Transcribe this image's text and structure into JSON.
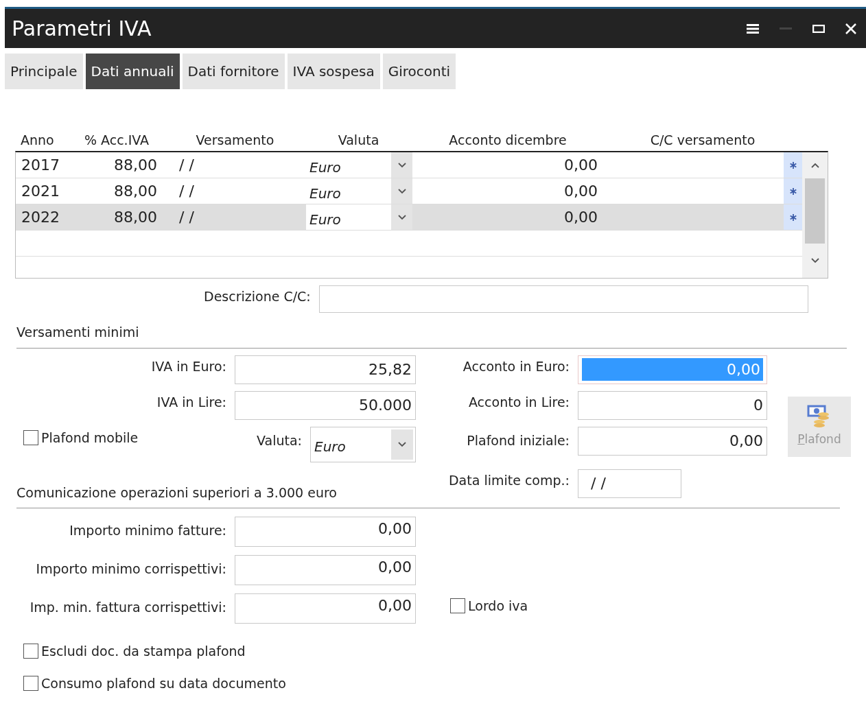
{
  "window": {
    "title": "Parametri IVA",
    "minimize_disabled": true
  },
  "tabs": [
    {
      "label": "Principale",
      "selected": false
    },
    {
      "label": "Dati annuali",
      "selected": true
    },
    {
      "label": "Dati fornitore",
      "selected": false
    },
    {
      "label": "IVA sospesa",
      "selected": false
    },
    {
      "label": "Giroconti",
      "selected": false
    }
  ],
  "table": {
    "columns": [
      "Anno",
      "% Acc.IVA",
      "Versamento",
      "Valuta",
      "Acconto dicembre",
      "C/C versamento"
    ],
    "rows": [
      {
        "anno": "2017",
        "acc_iva": "88,00",
        "versamento": "/ /",
        "valuta": "Euro",
        "acconto_dicembre": "0,00",
        "selected": false
      },
      {
        "anno": "2021",
        "acc_iva": "88,00",
        "versamento": "/ /",
        "valuta": "Euro",
        "acconto_dicembre": "0,00",
        "selected": false
      },
      {
        "anno": "2022",
        "acc_iva": "88,00",
        "versamento": "/ /",
        "valuta": "Euro",
        "acconto_dicembre": "0,00",
        "selected": true
      }
    ]
  },
  "descrizione_cc": {
    "label": "Descrizione C/C:"
  },
  "versamenti_minimi": {
    "title": "Versamenti minimi",
    "iva_euro": {
      "label": "IVA in Euro:",
      "value": "25,82"
    },
    "iva_lire": {
      "label": "IVA in Lire:",
      "value": "50.000"
    },
    "plafond_mobile": {
      "label": "Plafond mobile",
      "checked": false
    },
    "valuta": {
      "label": "Valuta:",
      "value": "Euro"
    },
    "acconto_euro": {
      "label": "Acconto in Euro:",
      "value": "0,00",
      "focused": true
    },
    "acconto_lire": {
      "label": "Acconto in Lire:",
      "value": "0",
      "focused": false
    },
    "plafond_iniziale": {
      "label": "Plafond iniziale:",
      "value": "0,00",
      "focused": false
    },
    "data_limite": {
      "label": "Data limite comp.:",
      "value": "/ /"
    },
    "plafond_button": {
      "label": "Plafond",
      "disabled": true
    }
  },
  "comunicazione": {
    "title": "Comunicazione operazioni superiori a 3.000 euro",
    "fields": [
      {
        "label": "Importo minimo fatture:",
        "value": "0,00"
      },
      {
        "label": "Importo minimo corrispettivi:",
        "value": "0,00"
      },
      {
        "label": "Imp. min. fattura corrispettivi:",
        "value": "0,00"
      }
    ],
    "lordo_iva": {
      "label": "Lordo iva",
      "checked": false
    }
  },
  "checkboxes": [
    {
      "label": "Escludi doc. da stampa plafond",
      "checked": false
    },
    {
      "label": "Consumo plafond su data documento",
      "checked": false
    }
  ]
}
